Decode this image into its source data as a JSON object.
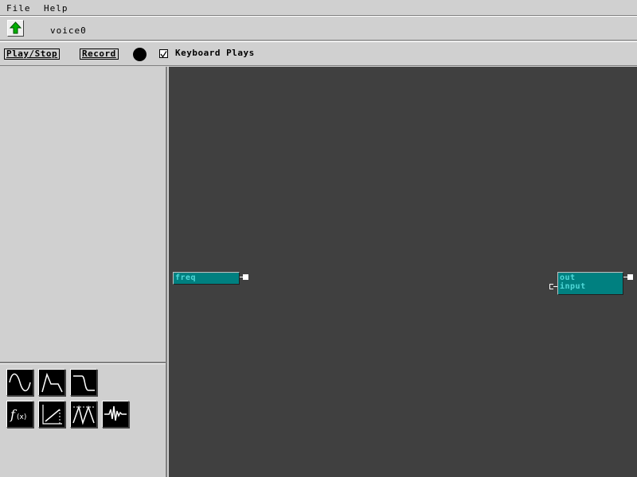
{
  "menu": {
    "file": "File",
    "help": "Help"
  },
  "header": {
    "voice_name": "voice0"
  },
  "transport": {
    "play_stop": "Play/Stop",
    "record": "Record",
    "keyboard_plays": "Keyboard Plays",
    "keyboard_plays_checked": true
  },
  "palette": {
    "buttons": [
      "sine-wave-icon",
      "envelope-icon",
      "lowpass-filter-icon",
      "function-icon",
      "ramp-icon",
      "bandpass-filter-icon",
      "sample-waveform-icon"
    ]
  },
  "canvas": {
    "nodes": [
      {
        "name": "freq-node",
        "label": "freq"
      },
      {
        "name": "output-node",
        "labels": [
          "out",
          "input"
        ]
      }
    ]
  },
  "colors": {
    "canvas": "#404040",
    "node": "#008080",
    "node_text": "#50d8d8",
    "panel": "#d0d0d0"
  }
}
